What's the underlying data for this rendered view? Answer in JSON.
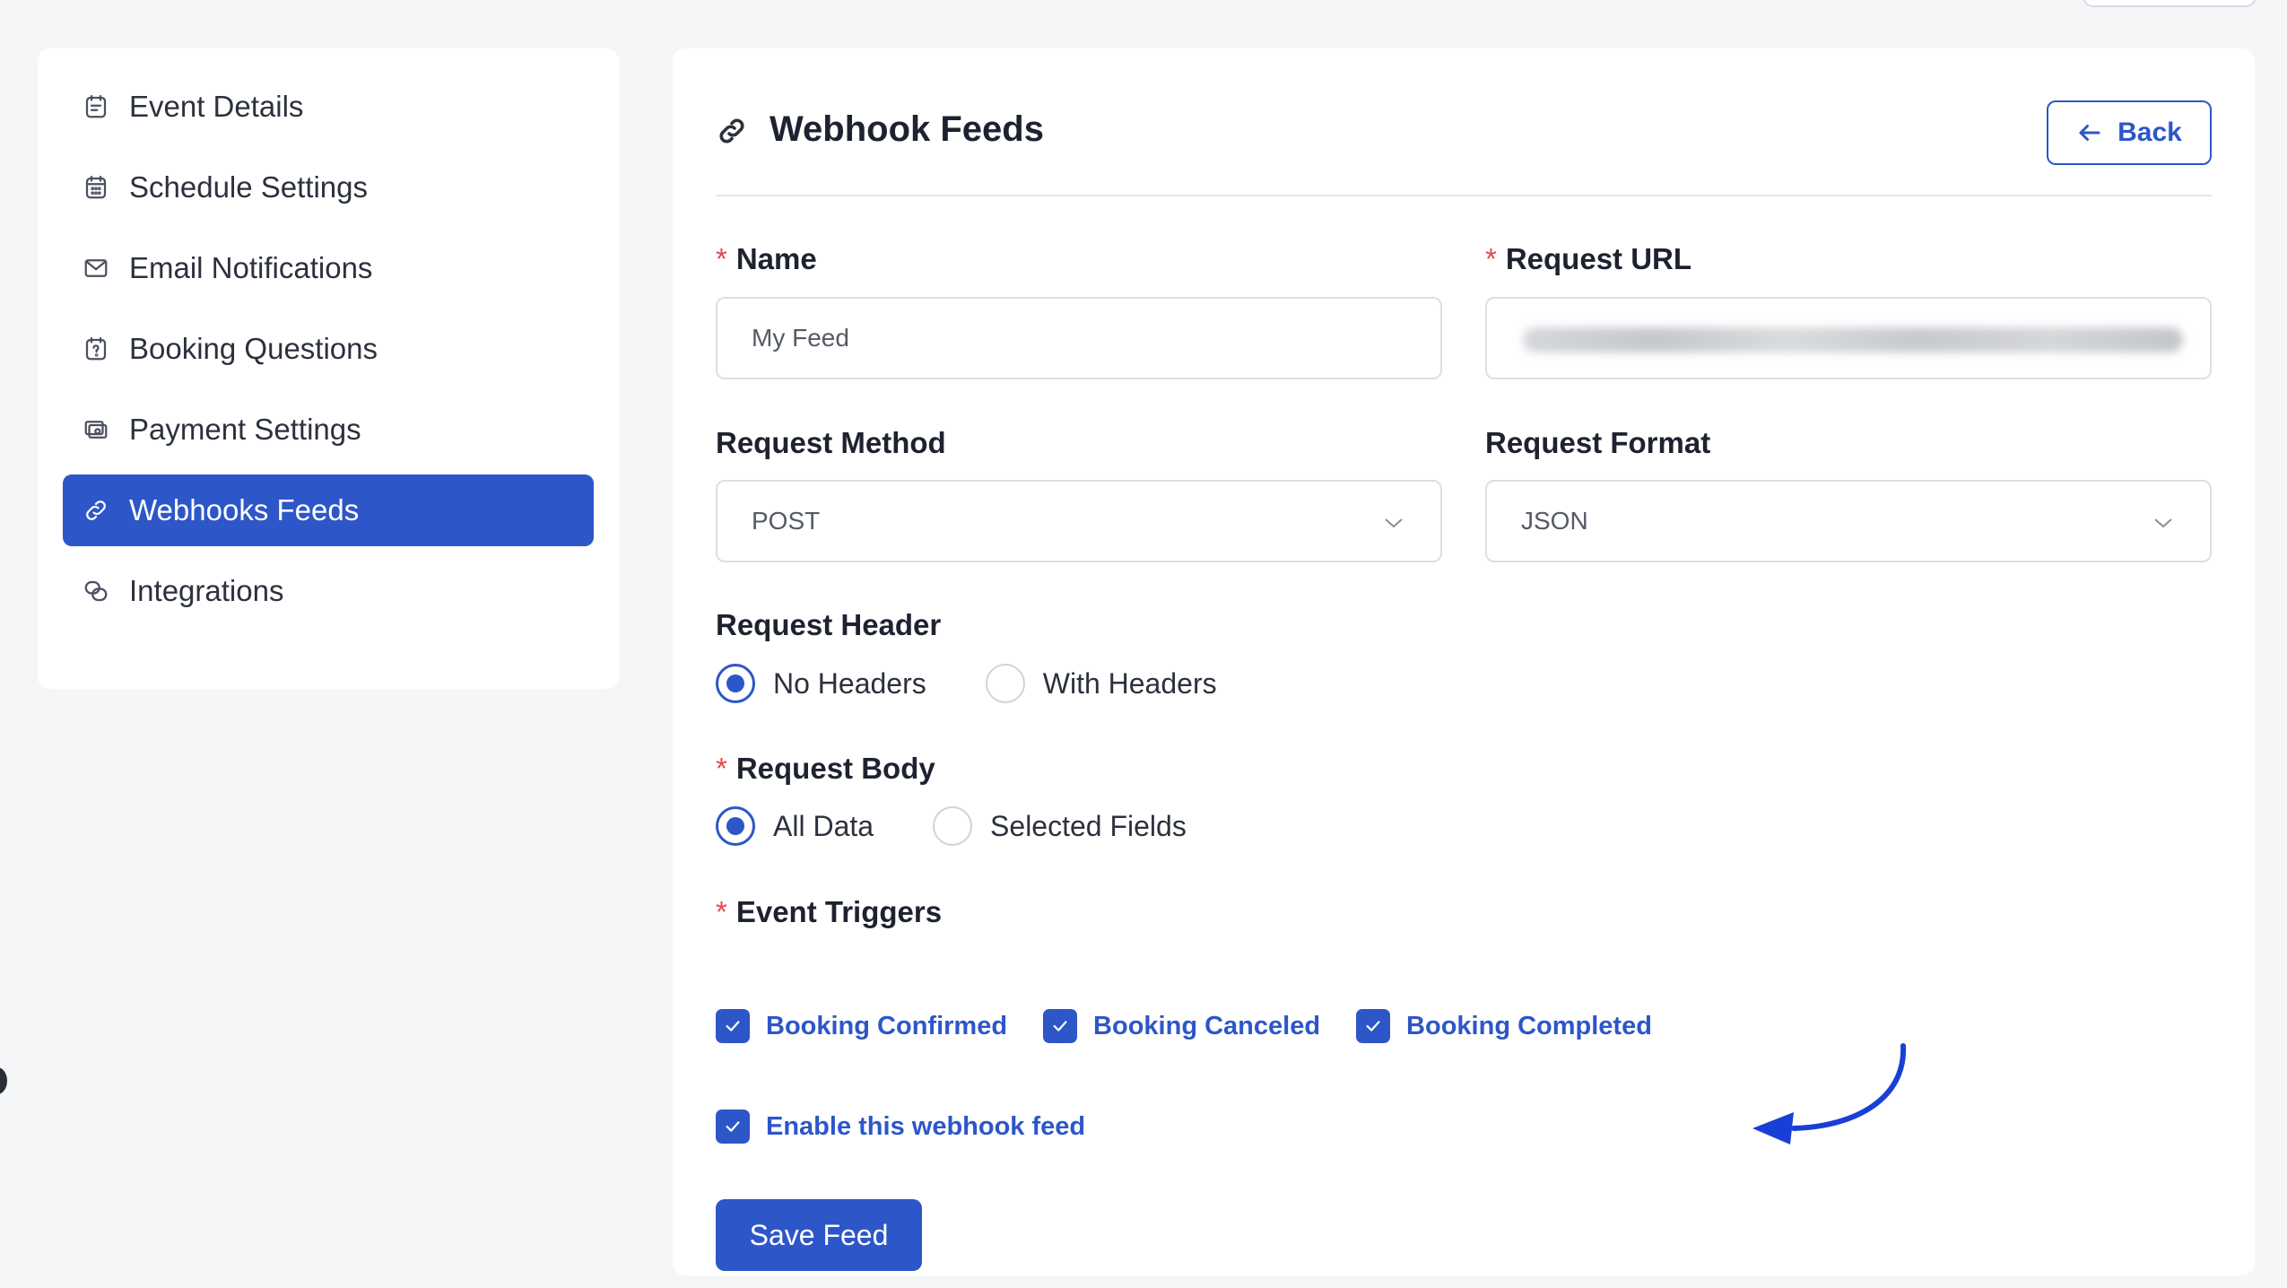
{
  "sidebar": {
    "items": [
      {
        "label": "Event Details",
        "icon": "calendar-note-icon",
        "active": false
      },
      {
        "label": "Schedule Settings",
        "icon": "calendar-grid-icon",
        "active": false
      },
      {
        "label": "Email Notifications",
        "icon": "mail-icon",
        "active": false
      },
      {
        "label": "Booking Questions",
        "icon": "question-calendar-icon",
        "active": false
      },
      {
        "label": "Payment Settings",
        "icon": "payment-icon",
        "active": false
      },
      {
        "label": "Webhooks Feeds",
        "icon": "link-icon",
        "active": true
      },
      {
        "label": "Integrations",
        "icon": "integrations-icon",
        "active": false
      }
    ]
  },
  "header": {
    "title": "Webhook Feeds",
    "title_icon": "link-icon",
    "back_label": "Back"
  },
  "form": {
    "name": {
      "label": "Name",
      "required": true,
      "placeholder": "My Feed"
    },
    "request_url": {
      "label": "Request URL",
      "required": true,
      "value_blurred": true
    },
    "request_method": {
      "label": "Request Method",
      "value": "POST"
    },
    "request_format": {
      "label": "Request Format",
      "value": "JSON"
    },
    "request_header": {
      "label": "Request Header",
      "options": [
        {
          "label": "No Headers",
          "selected": true
        },
        {
          "label": "With Headers",
          "selected": false
        }
      ]
    },
    "request_body": {
      "label": "Request Body",
      "required": true,
      "options": [
        {
          "label": "All Data",
          "selected": true
        },
        {
          "label": "Selected Fields",
          "selected": false
        }
      ]
    },
    "event_triggers": {
      "label": "Event Triggers",
      "required": true,
      "options": [
        {
          "label": "Booking Confirmed",
          "checked": true
        },
        {
          "label": "Booking Canceled",
          "checked": true
        },
        {
          "label": "Booking Completed",
          "checked": true
        }
      ]
    },
    "enable_feed": {
      "label": "Enable this webhook feed",
      "checked": true
    },
    "save_label": "Save Feed"
  },
  "colors": {
    "accent": "#2d56c8",
    "required": "#e5484d",
    "annotation_arrow": "#1a3fd6"
  }
}
